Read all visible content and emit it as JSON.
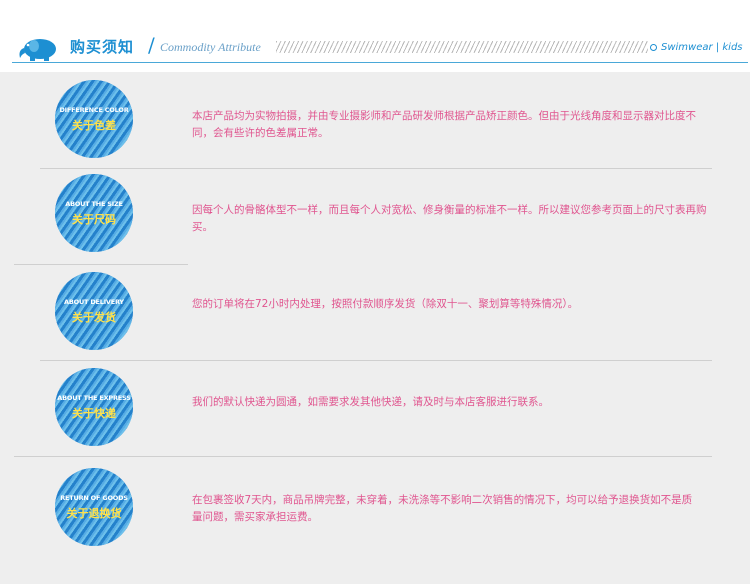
{
  "header": {
    "title": "购买须知",
    "slash": "/",
    "subtitle": "Commodity Attribute",
    "brand": "Swimwear",
    "brand_divider": "|",
    "brand_kids": "kids"
  },
  "colors": {
    "accent": "#1d8fd2",
    "text_pink": "#e0558f",
    "circle_label": "#ffe14a",
    "background": "#eeeeee"
  },
  "items": [
    {
      "en": "DIFFERENCE COLOR",
      "cn": "关于色差",
      "text": "本店产品均为实物拍摄，并由专业摄影师和产品研发师根据产品矫正颜色。但由于光线角度和显示器对比度不同，会有些许的色差属正常。"
    },
    {
      "en": "ABOUT THE SIZE",
      "cn": "关于尺码",
      "text": "因每个人的骨骼体型不一样，而且每个人对宽松、修身衡量的标准不一样。所以建议您参考页面上的尺寸表再购买。"
    },
    {
      "en": "ABOUT DELIVERY",
      "cn": "关于发货",
      "text": "您的订单将在72小时内处理，按照付款顺序发货（除双十一、聚划算等特殊情况）。"
    },
    {
      "en": "ABOUT THE EXPRESS",
      "cn": "关于快递",
      "text": "我们的默认快递为圆通，如需要求发其他快递，请及时与本店客服进行联系。"
    },
    {
      "en": "RETURN OF GOODS",
      "cn": "关于退换货",
      "text": "在包裹签收7天内，商品吊牌完整，未穿着，未洗涤等不影响二次销售的情况下，均可以给予退换货如不是质量问题，需买家承担运费。"
    }
  ]
}
